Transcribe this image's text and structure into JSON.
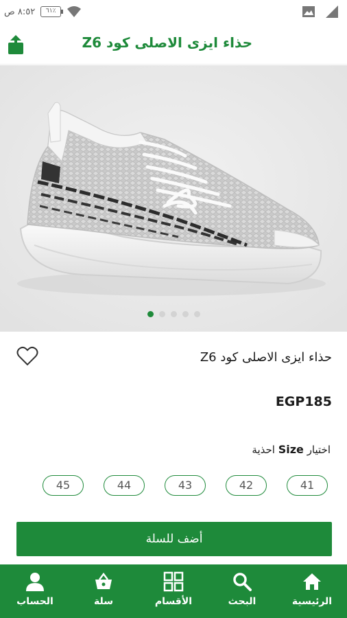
{
  "status_bar": {
    "time": "٨:٥٢ ص",
    "battery": "٦١٪"
  },
  "header": {
    "title": "حذاء ايزى الاصلى كود Z6"
  },
  "product": {
    "name": "حذاء ايزى الاصلى كود Z6",
    "price": "EGP185",
    "size_label_prefix": "اختيار",
    "size_label_bold": "Size",
    "size_label_suffix": "احذية",
    "sizes": [
      "45",
      "44",
      "43",
      "42",
      "41"
    ],
    "add_to_cart": "أضف للسلة"
  },
  "gallery": {
    "active_index": 0,
    "dot_count": 5
  },
  "bottom_nav": {
    "items": [
      {
        "label": "الرئيسية",
        "icon": "home-icon"
      },
      {
        "label": "البحث",
        "icon": "search-icon"
      },
      {
        "label": "الأقسام",
        "icon": "grid-icon"
      },
      {
        "label": "سلة",
        "icon": "basket-icon"
      },
      {
        "label": "الحساب",
        "icon": "account-icon"
      }
    ]
  },
  "colors": {
    "accent": "#1e8a3a"
  }
}
